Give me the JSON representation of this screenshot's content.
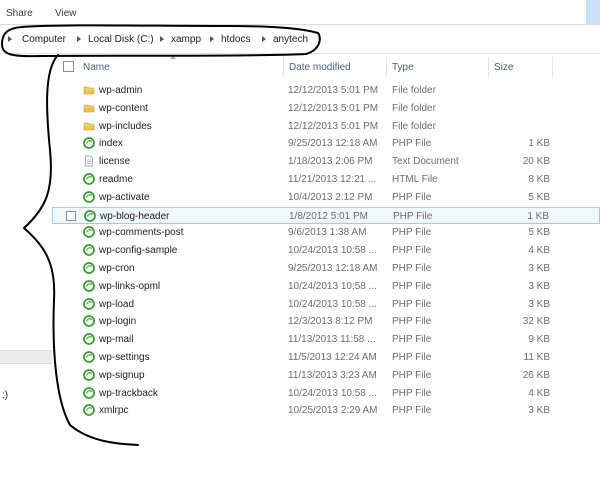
{
  "ribbon": {
    "tabs": [
      "Share",
      "View"
    ]
  },
  "breadcrumb": [
    "Computer",
    "Local Disk (C:)",
    "xampp",
    "htdocs",
    "anytech"
  ],
  "nav": {
    "partial_text": ":)"
  },
  "columns": {
    "name": "Name",
    "date": "Date modified",
    "type": "Type",
    "size": "Size"
  },
  "files": [
    {
      "name": "wp-admin",
      "date": "12/12/2013 5:01 PM",
      "type": "File folder",
      "size": "",
      "icon": "folder-icon"
    },
    {
      "name": "wp-content",
      "date": "12/12/2013 5:01 PM",
      "type": "File folder",
      "size": "",
      "icon": "folder-icon"
    },
    {
      "name": "wp-includes",
      "date": "12/12/2013 5:01 PM",
      "type": "File folder",
      "size": "",
      "icon": "folder-icon"
    },
    {
      "name": "index",
      "date": "9/25/2013 12:18 AM",
      "type": "PHP File",
      "size": "1 KB",
      "icon": "php-file-icon"
    },
    {
      "name": "license",
      "date": "1/18/2013 2:06 PM",
      "type": "Text Document",
      "size": "20 KB",
      "icon": "text-document-icon"
    },
    {
      "name": "readme",
      "date": "11/21/2013 12:21 ...",
      "type": "HTML File",
      "size": "8 KB",
      "icon": "php-file-icon"
    },
    {
      "name": "wp-activate",
      "date": "10/4/2013 2:12 PM",
      "type": "PHP File",
      "size": "5 KB",
      "icon": "php-file-icon"
    },
    {
      "name": "wp-blog-header",
      "date": "1/8/2012 5:01 PM",
      "type": "PHP File",
      "size": "1 KB",
      "icon": "php-file-icon",
      "selected": true
    },
    {
      "name": "wp-comments-post",
      "date": "9/6/2013 1:38 AM",
      "type": "PHP File",
      "size": "5 KB",
      "icon": "php-file-icon"
    },
    {
      "name": "wp-config-sample",
      "date": "10/24/2013 10:58 ...",
      "type": "PHP File",
      "size": "4 KB",
      "icon": "php-file-icon"
    },
    {
      "name": "wp-cron",
      "date": "9/25/2013 12:18 AM",
      "type": "PHP File",
      "size": "3 KB",
      "icon": "php-file-icon"
    },
    {
      "name": "wp-links-opml",
      "date": "10/24/2013 10:58 ...",
      "type": "PHP File",
      "size": "3 KB",
      "icon": "php-file-icon"
    },
    {
      "name": "wp-load",
      "date": "10/24/2013 10:58 ...",
      "type": "PHP File",
      "size": "3 KB",
      "icon": "php-file-icon"
    },
    {
      "name": "wp-login",
      "date": "12/3/2013 8:12 PM",
      "type": "PHP File",
      "size": "32 KB",
      "icon": "php-file-icon"
    },
    {
      "name": "wp-mail",
      "date": "11/13/2013 11:58 ...",
      "type": "PHP File",
      "size": "9 KB",
      "icon": "php-file-icon"
    },
    {
      "name": "wp-settings",
      "date": "11/5/2013 12:24 AM",
      "type": "PHP File",
      "size": "11 KB",
      "icon": "php-file-icon"
    },
    {
      "name": "wp-signup",
      "date": "11/13/2013 3:23 AM",
      "type": "PHP File",
      "size": "26 KB",
      "icon": "php-file-icon"
    },
    {
      "name": "wp-trackback",
      "date": "10/24/2013 10:58 ...",
      "type": "PHP File",
      "size": "4 KB",
      "icon": "php-file-icon"
    },
    {
      "name": "xmlrpc",
      "date": "10/25/2013 2:29 AM",
      "type": "PHP File",
      "size": "3 KB",
      "icon": "php-file-icon"
    }
  ],
  "colors": {
    "selection_border": "#99cfe8",
    "selection_fill": "#f0f7fd",
    "folder": "#e8c35a",
    "php_green": "#3c9a3c",
    "header_text": "#4c607a"
  }
}
